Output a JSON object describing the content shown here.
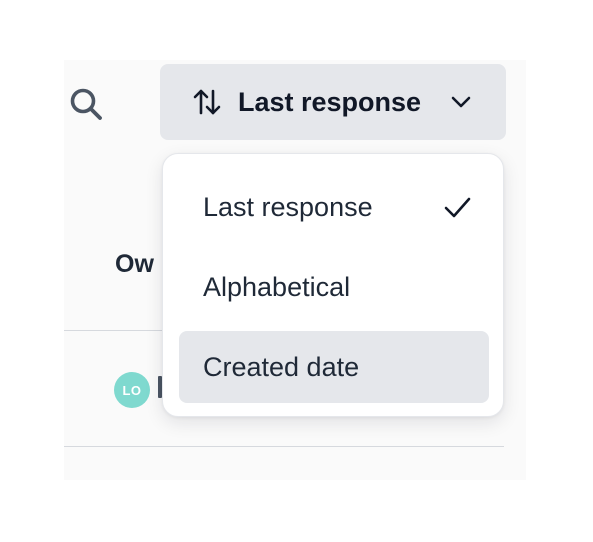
{
  "toolbar": {
    "search_icon": "search-icon",
    "sort_button": {
      "icon": "sort-arrows-icon",
      "label": "Last response",
      "chevron_icon": "chevron-down-icon"
    }
  },
  "sort_menu": {
    "items": [
      {
        "label": "Last response",
        "selected": true,
        "icon": "check-icon"
      },
      {
        "label": "Alphabetical",
        "selected": false
      },
      {
        "label": "Created date",
        "selected": false,
        "highlighted": true
      }
    ]
  },
  "table": {
    "header_owner": "Ow",
    "rows": [
      {
        "avatar_initials": "LO",
        "avatar_color": "#7fd9cf"
      }
    ]
  },
  "colors": {
    "button_bg": "#e5e7eb",
    "hover_bg": "#e5e7eb",
    "text_primary": "#111827",
    "divider": "#d6d9de"
  }
}
